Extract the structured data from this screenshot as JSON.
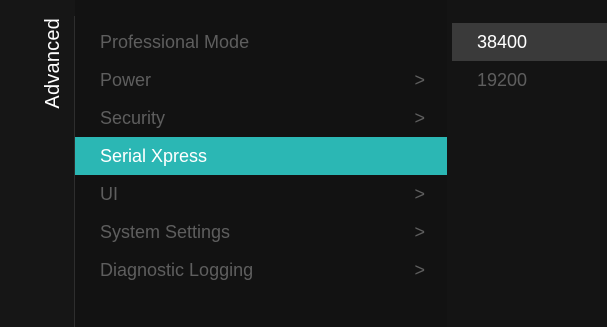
{
  "sidebar": {
    "title": "Advanced"
  },
  "menu": {
    "items": [
      {
        "label": "Professional Mode",
        "chevron": ""
      },
      {
        "label": "Power",
        "chevron": ">"
      },
      {
        "label": "Security",
        "chevron": ">"
      },
      {
        "label": "Serial Xpress",
        "chevron": ""
      },
      {
        "label": "UI",
        "chevron": ">"
      },
      {
        "label": "System Settings",
        "chevron": ">"
      },
      {
        "label": "Diagnostic Logging",
        "chevron": ">"
      }
    ],
    "selected_index": 3
  },
  "submenu": {
    "options": [
      {
        "label": "38400"
      },
      {
        "label": "19200"
      }
    ],
    "focused_index": 0
  },
  "colors": {
    "accent": "#2bb7b4",
    "background": "#121212",
    "inactive_text": "#5e5e5e",
    "active_text": "#ffffff",
    "submenu_highlight": "#3a3a3a"
  }
}
